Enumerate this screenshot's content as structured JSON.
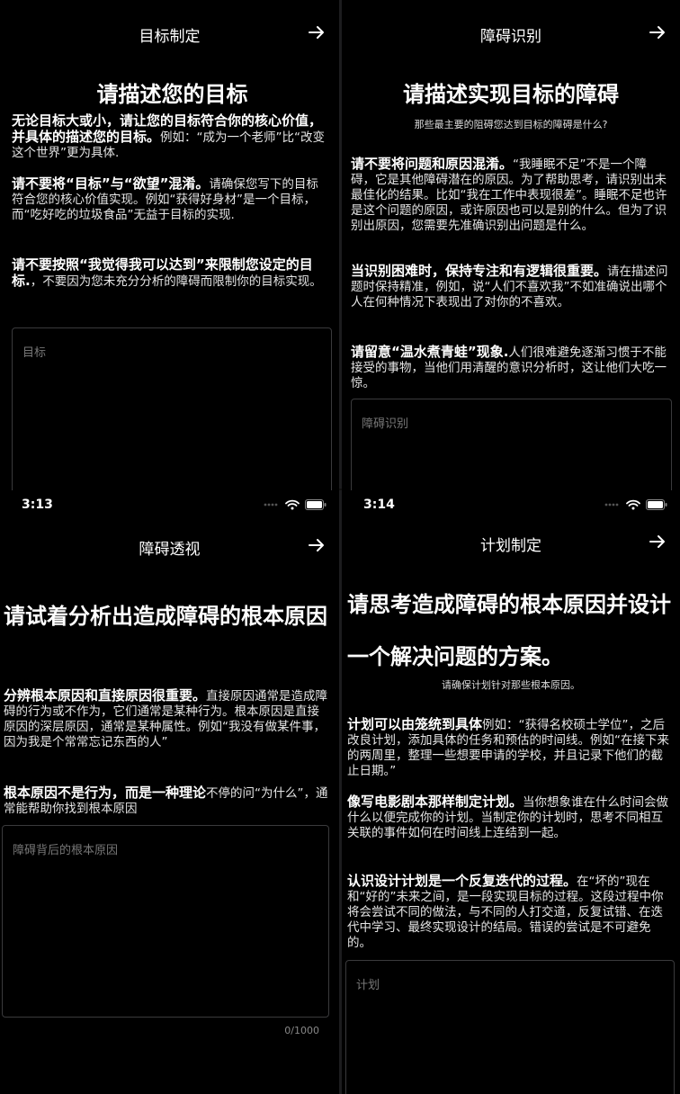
{
  "p1": {
    "nav_title": "目标制定",
    "heading": "请描述您的目标",
    "para1_bold": "无论目标大或小，请让您的目标符合你的核心价值，并具体的描述您的目标。",
    "para1_rest": "例如：“成为一个老师”比“改变这个世界”更为具体.",
    "para2_bold": "请不要将“目标”与“欲望”混淆。",
    "para2_rest": "请确保您写下的目标符合您的核心价值实现。例如“获得好身材”是一个目标，而“吃好吃的垃圾食品”无益于目标的实现.",
    "para3_bold": "请不要按照“我觉得我可以达到”来限制您设定的目标.",
    "para3_rest": "，不要因为您未充分分析的障碍而限制你的目标实现。",
    "input_placeholder": "目标"
  },
  "p2": {
    "nav_title": "障碍识别",
    "heading": "请描述实现目标的障碍",
    "subtitle": "那些最主要的阻碍您达到目标的障碍是什么?",
    "para1_bold": "请不要将问题和原因混淆。",
    "para1_rest": "“我睡眠不足”不是一个障碍，它是其他障碍潜在的原因。为了帮助思考，请识别出未最佳化的结果。比如“我在工作中表现很差”。睡眠不足也许是这个问题的原因，或许原因也可以是别的什么。但为了识别出原因，您需要先准确识别出问题是什么。",
    "para2_bold": "当识别困难时，保持专注和有逻辑很重要。",
    "para2_rest": "请在描述问题时保持精准，例如，说“人们不喜欢我”不如准确说出哪个人在何种情况下表现出了对你的不喜欢。",
    "para3_bold": "请留意“温水煮青蛙”现象.",
    "para3_rest": "人们很难避免逐渐习惯于不能接受的事物，当他们用清醒的意识分析时，这让他们大吃一惊。",
    "input_placeholder": "障碍识别"
  },
  "p3": {
    "status_time": "3:13",
    "nav_title": "障碍透视",
    "heading": "请试着分析出造成障碍的根本原因",
    "para1_bold": "分辨根本原因和直接原因很重要。",
    "para1_rest": "直接原因通常是造成障碍的行为或不作为，它们通常是某种行为。根本原因是直接原因的深层原因，通常是某种属性。例如“我没有做某件事，因为我是个常常忘记东西的人”",
    "para2_bold": "根本原因不是行为，而是一种理论",
    "para2_rest": "不停的问“为什么”，通常能帮助你找到根本原因",
    "input_placeholder": "障碍背后的根本原因",
    "counter": "0/1000"
  },
  "p4": {
    "status_time": "3:14",
    "nav_title": "计划制定",
    "heading": "请思考造成障碍的根本原因并设计一个解决问题的方案。",
    "subtitle": "请确保计划针对那些根本原因。",
    "para1_bold": "计划可以由笼统到具体",
    "para1_rest": "例如：“获得名校硕士学位”，之后改良计划，添加具体的任务和预估的时间线。例如“在接下来的两周里，整理一些想要申请的学校，并且记录下他们的截止日期。”",
    "para2_bold": "像写电影剧本那样制定计划。",
    "para2_rest": "当你想象谁在什么时间会做什么以便完成你的计划。当制定你的计划时，思考不同相互关联的事件如何在时间线上连结到一起。",
    "para3_bold": "认识设计计划是一个反复迭代的过程。",
    "para3_rest": "在“坏的”现在和“好的”未来之间，是一段实现目标的过程。这段过程中你将会尝试不同的做法，与不同的人打交道，反复试错、在迭代中学习、最终实现设计的结局。错误的尝试是不可避免的。",
    "input_placeholder": "计划"
  },
  "icons": {
    "next": "arrow-right-icon",
    "wifi": "wifi-icon",
    "battery": "battery-icon",
    "signal": "signal-dots-icon"
  }
}
